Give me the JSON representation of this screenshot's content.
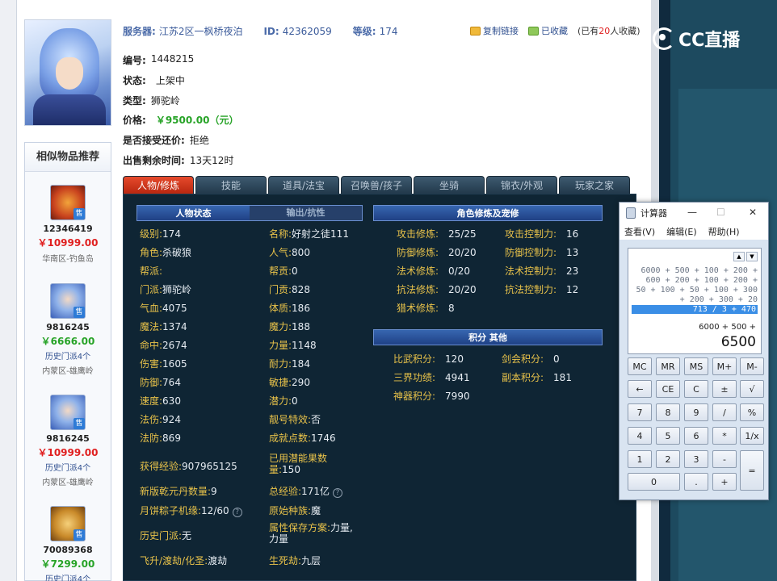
{
  "header": {
    "server_label": "服务器:",
    "server_value": "江苏2区一枫桥夜泊",
    "id_label": "ID:",
    "id_value": "42362059",
    "level_label": "等级:",
    "level_value": "174",
    "copy_link": "复制链接",
    "favorited": "已收藏",
    "fav_prefix": "(已有",
    "fav_count": "20",
    "fav_suffix": "人收藏)"
  },
  "logo": {
    "text": "CC直播"
  },
  "info": {
    "number_label": "编号:",
    "number_value": "1448215",
    "status_label": "状态:",
    "status_value": "上架中",
    "type_label": "类型:",
    "type_value": "狮驼岭",
    "price_label": "价格:",
    "price_value": "￥9500.00（元）",
    "bargain_label": "是否接受还价:",
    "bargain_value": "拒绝",
    "remain_label": "出售剩余时间:",
    "remain_value": "13天12时"
  },
  "similar": {
    "title": "相似物品推荐",
    "items": [
      {
        "id": "12346419",
        "price": "￥10999.00",
        "history": "",
        "server": "华南区-钓鱼岛",
        "price_color": "red",
        "thumb": "monkey-icon"
      },
      {
        "id": "9816245",
        "price": "￥6666.00",
        "history": "历史门派4个",
        "server": "内蒙区-雄鹰岭",
        "price_color": "green",
        "thumb": "blue-hair-icon"
      },
      {
        "id": "9816245",
        "price": "￥10999.00",
        "history": "历史门派4个",
        "server": "内蒙区-雄鹰岭",
        "price_color": "red",
        "thumb": "blue-hair-icon"
      },
      {
        "id": "70089368",
        "price": "￥7299.00",
        "history": "历史门派4个",
        "server": "",
        "price_color": "green",
        "thumb": "lion-icon"
      }
    ],
    "sale_tag": "售"
  },
  "tabs": [
    "人物/修炼",
    "技能",
    "道具/法宝",
    "召唤兽/孩子",
    "坐骑",
    "锦衣/外观",
    "玩家之家"
  ],
  "panel": {
    "char_status": "人物状态",
    "output_resist": "输出/抗性",
    "cultivation_title": "角色修炼及宠修",
    "score_title": "积分 其他",
    "left_col": [
      {
        "label": "级别:",
        "value": "174"
      },
      {
        "label": "角色:",
        "value": "杀破狼"
      },
      {
        "label": "帮派:",
        "value": ""
      },
      {
        "label": "门派:",
        "value": "狮驼岭"
      },
      {
        "label": "气血:",
        "value": "4075"
      },
      {
        "label": "魔法:",
        "value": "1374"
      },
      {
        "label": "命中:",
        "value": "2674"
      },
      {
        "label": "伤害:",
        "value": "1605"
      },
      {
        "label": "防御:",
        "value": "764"
      },
      {
        "label": "速度:",
        "value": "630"
      },
      {
        "label": "法伤:",
        "value": "924"
      },
      {
        "label": "法防:",
        "value": "869"
      }
    ],
    "mid_col": [
      {
        "label": "名称:",
        "value": "好射之徒111"
      },
      {
        "label": "人气:",
        "value": "800"
      },
      {
        "label": "帮贡:",
        "value": "0"
      },
      {
        "label": "门贡:",
        "value": "828"
      },
      {
        "label": "体质:",
        "value": "186"
      },
      {
        "label": "魔力:",
        "value": "188"
      },
      {
        "label": "力量:",
        "value": "1148"
      },
      {
        "label": "耐力:",
        "value": "184"
      },
      {
        "label": "敏捷:",
        "value": "290"
      },
      {
        "label": "潜力:",
        "value": "0"
      },
      {
        "label": "靓号特效:",
        "value": "否"
      },
      {
        "label": "成就点数:",
        "value": "1746"
      }
    ],
    "extra_left": [
      {
        "label": "获得经验:",
        "value": "907965125"
      },
      {
        "label": "新版乾元丹数量:",
        "value": "9"
      },
      {
        "label": "月饼粽子机缘:",
        "value": "12/60"
      },
      {
        "label": "历史门派:",
        "value": "无"
      },
      {
        "label": "飞升/渡劫/化圣:",
        "value": "渡劫"
      }
    ],
    "extra_mid": [
      {
        "label": "已用潜能果数量:",
        "value": "150"
      },
      {
        "label": "总经验:",
        "value": "171亿"
      },
      {
        "label": "原始种族:",
        "value": "魔"
      },
      {
        "label": "属性保存方案:",
        "value": "力量,力量"
      },
      {
        "label": "生死劫:",
        "value": "九层"
      }
    ],
    "cult_left": [
      {
        "label": "攻击修炼:",
        "value": "25/25"
      },
      {
        "label": "防御修炼:",
        "value": "20/20"
      },
      {
        "label": "法术修炼:",
        "value": "0/20"
      },
      {
        "label": "抗法修炼:",
        "value": "20/20"
      },
      {
        "label": "猎术修炼:",
        "value": "8"
      }
    ],
    "cult_right": [
      {
        "label": "攻击控制力:",
        "value": "16"
      },
      {
        "label": "防御控制力:",
        "value": "13"
      },
      {
        "label": "法术控制力:",
        "value": "23"
      },
      {
        "label": "抗法控制力:",
        "value": "12"
      }
    ],
    "scores_left": [
      {
        "label": "比武积分:",
        "value": "120"
      },
      {
        "label": "三界功绩:",
        "value": "4941"
      },
      {
        "label": "神器积分:",
        "value": "7990"
      }
    ],
    "scores_right": [
      {
        "label": "剑会积分:",
        "value": "0"
      },
      {
        "label": "副本积分:",
        "value": "181"
      }
    ]
  },
  "calculator": {
    "title": "计算器",
    "menu": [
      "查看(V)",
      "编辑(E)",
      "帮助(H)"
    ],
    "history": [
      "6000 + 500 + 100 + 200 +",
      "600 + 200 + 100 + 200 +",
      "50 + 100 + 50 + 100 + 300",
      "+ 200 + 300 + 20",
      "713 / 3 + 470"
    ],
    "current_expr": "6000 + 500 +",
    "current_value": "6500",
    "buttons": [
      [
        "MC",
        "MR",
        "MS",
        "M+",
        "M-"
      ],
      [
        "←",
        "CE",
        "C",
        "±",
        "√"
      ],
      [
        "7",
        "8",
        "9",
        "/",
        "%"
      ],
      [
        "4",
        "5",
        "6",
        "*",
        "1/x"
      ],
      [
        "1",
        "2",
        "3",
        "-",
        "="
      ],
      [
        "0",
        ".",
        "+"
      ]
    ]
  }
}
